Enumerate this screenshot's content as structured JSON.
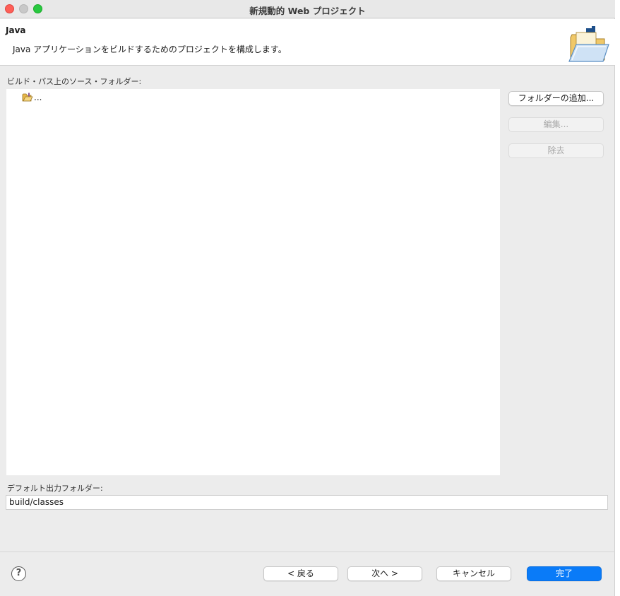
{
  "window": {
    "title": "新規動的 Web プロジェクト"
  },
  "header": {
    "title": "Java",
    "description": "Java アプリケーションをビルドするためのプロジェクトを構成します。",
    "icon": "folder-wizard-icon"
  },
  "source_folders": {
    "label": "ビルド・パス上のソース・フォルダー:",
    "items": [
      {
        "icon": "source-folder-icon",
        "label": "..."
      }
    ]
  },
  "side_buttons": {
    "add_folder": "フォルダーの追加...",
    "edit": "編集...",
    "remove": "除去"
  },
  "output": {
    "label": "デフォルト出力フォルダー:",
    "value": "build/classes"
  },
  "footer": {
    "help": "?",
    "back": "< 戻る",
    "next": "次へ >",
    "cancel": "キャンセル",
    "finish": "完了"
  },
  "colors": {
    "primary_button": "#0a7bf8",
    "close": "#fe5f57",
    "zoom": "#28c840"
  }
}
